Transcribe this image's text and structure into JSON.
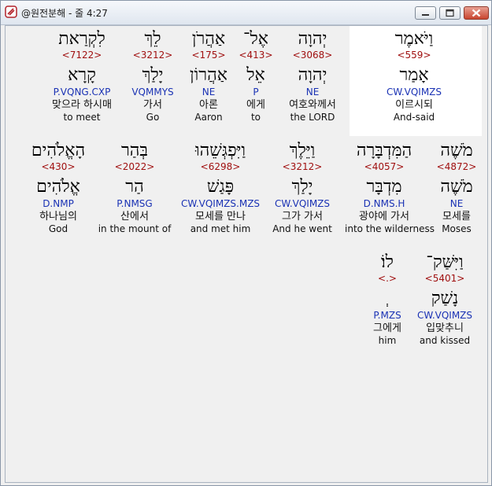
{
  "window": {
    "title": "@원전분해 - 줄 4:27"
  },
  "lines": [
    {
      "words": [
        {
          "heb": "וַיֹּאמֶר",
          "strong": "<559>",
          "root": "אָמַר",
          "parse": "CW.VQIMZS",
          "ko": "이르시되",
          "en": "And-said"
        },
        {
          "heb": "יְהוָה",
          "strong": "<3068>",
          "root": "יְהוָה",
          "parse": "NE",
          "ko": "여호와께서",
          "en": "the LORD"
        },
        {
          "heb": "אֶל־",
          "strong": "<413>",
          "root": "אֵל",
          "parse": "P",
          "ko": "에게",
          "en": "to"
        },
        {
          "heb": "אַהֲרֹן",
          "strong": "<175>",
          "root": "אַהֲרוֹן",
          "parse": "NE",
          "ko": "아론",
          "en": "Aaron"
        },
        {
          "heb": "לֵךְ",
          "strong": "<3212>",
          "root": "יָלַךְ",
          "parse": "VQMMYS",
          "ko": "가서",
          "en": "Go"
        },
        {
          "heb": "לִקְרַאת",
          "strong": "<7122>",
          "root": "קָרָא",
          "parse": "P.VQNG.CXP",
          "ko": "맞으라 하시매",
          "en": "to meet"
        }
      ]
    },
    {
      "words": [
        {
          "heb": "מֹשֶׁה",
          "strong": "<4872>",
          "root": "מֹשֶׁה",
          "parse": "NE",
          "ko": "모세를",
          "en": "Moses"
        },
        {
          "heb": "הַמִּדְבָּרָה",
          "strong": "<4057>",
          "root": "מִדְבָּר",
          "parse": "D.NMS.H",
          "ko": "광야에 가서",
          "en": "into the wilderness"
        },
        {
          "heb": "וַיֵּלֶךְ",
          "strong": "<3212>",
          "root": "יָלַךְ",
          "parse": "CW.VQIMZS",
          "ko": "그가 가서",
          "en": "And he went"
        },
        {
          "heb": "וַיִּפְגְּשֵׁהוּ",
          "strong": "<6298>",
          "root": "פָּגַשׁ",
          "parse": "CW.VQIMZS.MZS",
          "ko": "모세를 만나",
          "en": "and met him"
        },
        {
          "heb": "בְּהַר",
          "strong": "<2022>",
          "root": "הַר",
          "parse": "P.NMSG",
          "ko": "산에서",
          "en": "in the mount of"
        },
        {
          "heb": "הָאֱלֹהִים",
          "strong": "<430>",
          "root": "אֱלֹהִים",
          "parse": "D.NMP",
          "ko": "하나님의",
          "en": "God"
        }
      ]
    },
    {
      "words": [
        {
          "heb": "וַיִּשַּׁק־",
          "strong": "<5401>",
          "root": "נָשַׁק",
          "parse": "CW.VQIMZS",
          "ko": "입맞추니",
          "en": "and kissed"
        },
        {
          "heb": "לוֹ׃",
          "strong": "<.>",
          "root": "ְ",
          "parse": "P.MZS",
          "ko": "그에게",
          "en": "him"
        }
      ]
    }
  ]
}
